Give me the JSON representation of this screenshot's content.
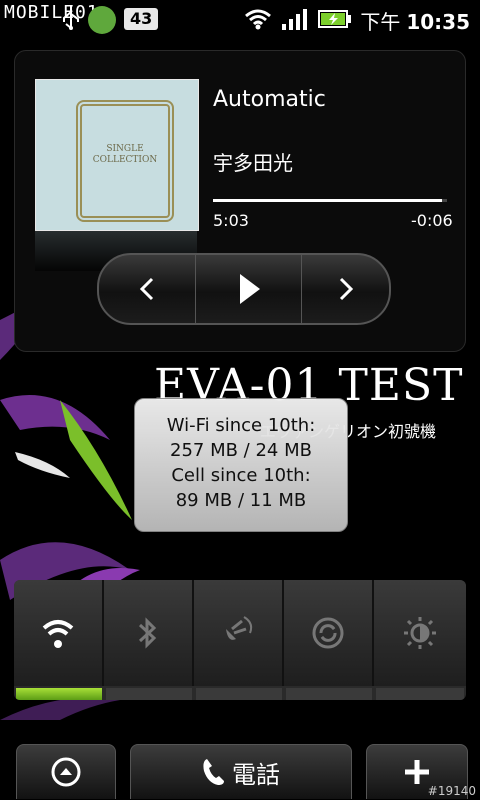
{
  "status_bar": {
    "logo": "MOBILE01",
    "badge_count": "43",
    "time_period": "下午",
    "time": "10:35"
  },
  "music_widget": {
    "album_text": "SINGLE COLLECTION",
    "track_title": "Automatic",
    "artist": "宇多田光",
    "elapsed": "5:03",
    "remaining": "-0:06",
    "progress": 0.98,
    "prev_label": "",
    "play_label": "",
    "next_label": ""
  },
  "wallpaper": {
    "title": "EVA-01 TEST",
    "subtitle": "エヴァンゲリオン初號機"
  },
  "data_usage": {
    "wifi_label": "Wi-Fi since 10th:",
    "wifi_value": "257 MB / 24 MB",
    "cell_label": "Cell since 10th:",
    "cell_value": "89 MB / 11 MB"
  },
  "quick_settings": {
    "items": [
      {
        "name": "wifi",
        "on": true
      },
      {
        "name": "bluetooth",
        "on": false
      },
      {
        "name": "gps",
        "on": false
      },
      {
        "name": "sync",
        "on": false
      },
      {
        "name": "brightness",
        "on": false
      }
    ]
  },
  "dock": {
    "phone_label": "電話",
    "watermark": "#19140"
  }
}
